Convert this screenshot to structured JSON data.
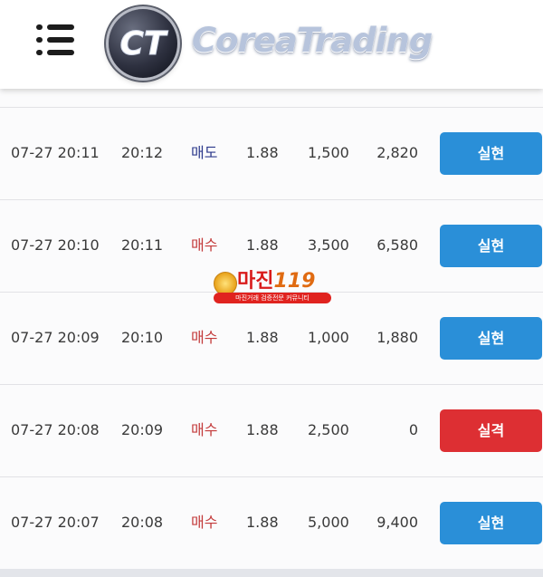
{
  "header": {
    "brand": "CoreaTrading",
    "emblem_letters": "CT",
    "menu_icon": "hamburger-menu-icon"
  },
  "watermark": {
    "title": "마진",
    "number": "119",
    "subtitle": "마진거래 검증전문 커뮤니티"
  },
  "colors": {
    "win_button": "#2a8fd8",
    "loss_button": "#dd2f33",
    "sell_text": "#2d3a8c",
    "buy_text": "#c33a3a"
  },
  "trades": [
    {
      "time": "07-27 20:11",
      "close": "20:12",
      "side": "매도",
      "side_type": "sell",
      "rate": "1.88",
      "qty": "1,500",
      "amount": "2,820",
      "result": "실현",
      "result_type": "win"
    },
    {
      "time": "07-27 20:10",
      "close": "20:11",
      "side": "매수",
      "side_type": "buy",
      "rate": "1.88",
      "qty": "3,500",
      "amount": "6,580",
      "result": "실현",
      "result_type": "win"
    },
    {
      "time": "07-27 20:09",
      "close": "20:10",
      "side": "매수",
      "side_type": "buy",
      "rate": "1.88",
      "qty": "1,000",
      "amount": "1,880",
      "result": "실현",
      "result_type": "win"
    },
    {
      "time": "07-27 20:08",
      "close": "20:09",
      "side": "매수",
      "side_type": "buy",
      "rate": "1.88",
      "qty": "2,500",
      "amount": "0",
      "result": "실격",
      "result_type": "loss"
    },
    {
      "time": "07-27 20:07",
      "close": "20:08",
      "side": "매수",
      "side_type": "buy",
      "rate": "1.88",
      "qty": "5,000",
      "amount": "9,400",
      "result": "실현",
      "result_type": "win"
    }
  ]
}
